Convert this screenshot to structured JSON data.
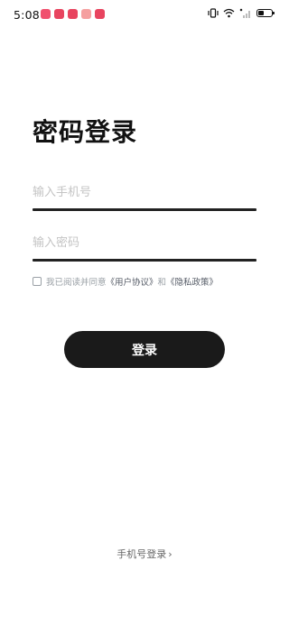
{
  "status_bar": {
    "time": "5:08",
    "notification_icons": [
      {
        "name": "app-notification-icon",
        "color": "#f0506e"
      },
      {
        "name": "app-notification-icon",
        "color": "#e8445f"
      },
      {
        "name": "app-notification-icon",
        "color": "#e8445f"
      },
      {
        "name": "app-notification-icon",
        "color": "#f5a0a0"
      },
      {
        "name": "app-notification-icon",
        "color": "#e8445f"
      }
    ],
    "right_icons": [
      "vibrate-icon",
      "wifi-icon",
      "cellular-signal-icon",
      "battery-icon"
    ],
    "battery_level": 0.4
  },
  "login": {
    "title": "密码登录",
    "phone_placeholder": "输入手机号",
    "phone_value": "",
    "password_placeholder": "输入密码",
    "password_value": "",
    "agreement": {
      "prefix": "我已阅读并同意",
      "user_agreement": "《用户协议》",
      "conjunction": "和",
      "privacy_policy": "《隐私政策》",
      "checked": false
    },
    "submit_label": "登录",
    "switch_label": "手机号登录",
    "switch_icon": "chevron-right-icon"
  },
  "colors": {
    "primary": "#1a1a1a",
    "placeholder": "#c4c4c4",
    "muted": "#9aa0a6"
  }
}
